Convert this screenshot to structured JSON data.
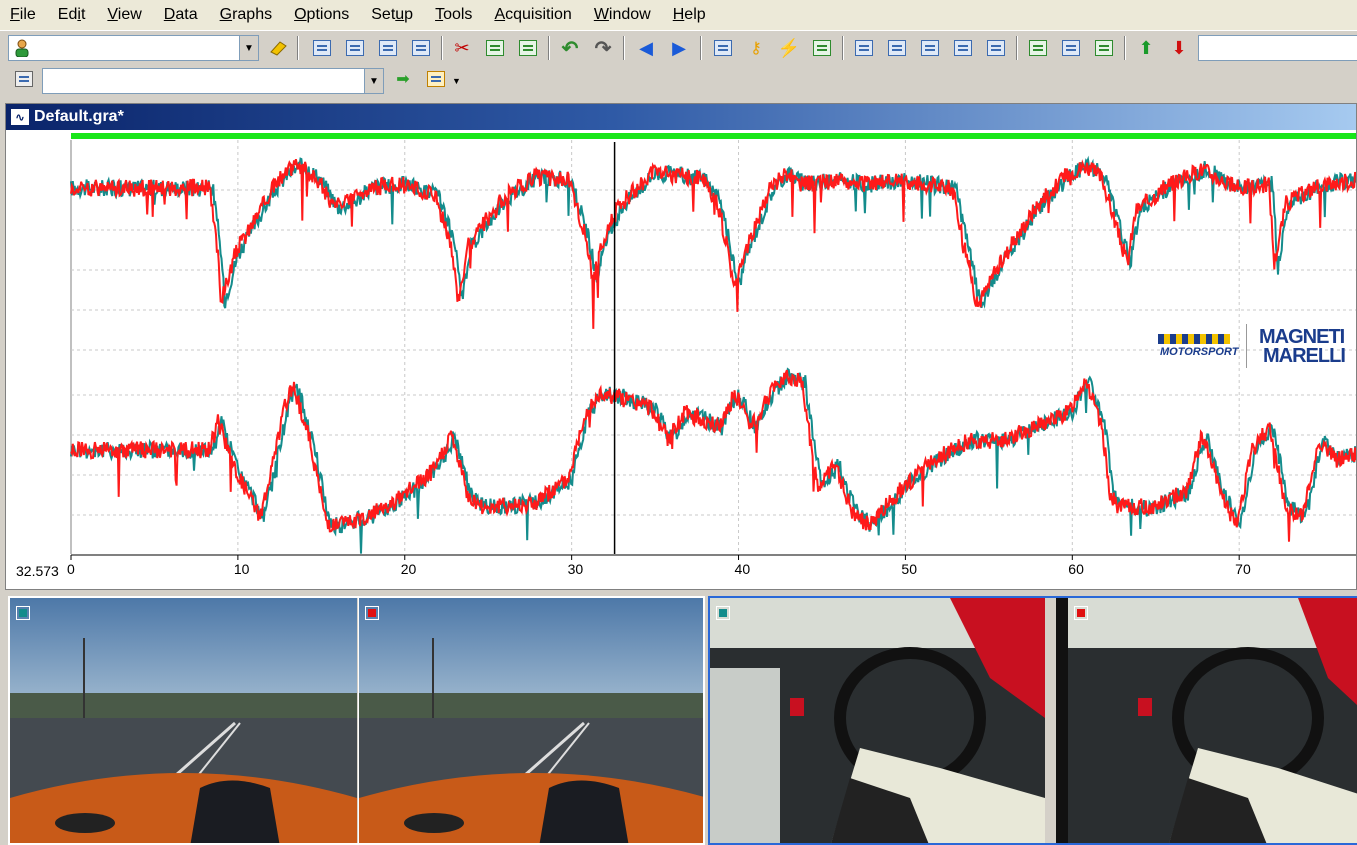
{
  "menu": [
    "File",
    "Edit",
    "View",
    "Data",
    "Graphs",
    "Options",
    "Setup",
    "Tools",
    "Acquisition",
    "Window",
    "Help"
  ],
  "menu_access_keys": [
    "F",
    "i",
    "V",
    "D",
    "G",
    "O",
    "u",
    "T",
    "A",
    "W",
    "H"
  ],
  "toolbar": {
    "user_combo_value": "",
    "secondary_combo_value": "",
    "right_input_value": ""
  },
  "graph_window": {
    "title": "Default.gra*",
    "cursor_value": "32.573",
    "x_ticks": [
      "0",
      "10",
      "20",
      "30",
      "40",
      "50",
      "60",
      "70"
    ],
    "logo_left": "MOTORSPORT",
    "logo_right_line1": "MAGNETI",
    "logo_right_line2": "MARELLI"
  },
  "colors": {
    "series_a": "#148c8c",
    "series_b": "#ff1a1a",
    "range_bar": "#19e619",
    "cursor": "#000000"
  },
  "chart_data": {
    "type": "line",
    "x_range": [
      0,
      77
    ],
    "cursor_x": 32.573,
    "grid": true,
    "panels": [
      {
        "name": "",
        "series": [
          {
            "name": "",
            "color": "teal",
            "x": [
              0,
              8.5,
              9,
              9.2,
              10,
              12,
              13,
              14,
              15,
              16,
              17,
              18,
              20,
              22,
              23,
              23.4,
              24,
              26,
              28,
              30,
              31,
              31.5,
              32,
              33,
              35,
              38,
              39,
              40,
              40.5,
              42,
              43,
              44,
              46,
              48,
              50,
              53,
              54,
              54.5,
              56,
              58,
              60,
              61,
              62,
              63,
              63.5,
              64,
              66,
              68,
              70,
              72,
              72.3,
              73,
              75,
              77
            ],
            "y": [
              0.8,
              0.8,
              0.45,
              0.2,
              0.45,
              0.76,
              0.88,
              0.92,
              0.84,
              0.7,
              0.73,
              0.8,
              0.82,
              0.76,
              0.5,
              0.2,
              0.5,
              0.74,
              0.86,
              0.84,
              0.55,
              0.32,
              0.5,
              0.7,
              0.88,
              0.85,
              0.7,
              0.28,
              0.45,
              0.78,
              0.88,
              0.82,
              0.84,
              0.82,
              0.84,
              0.8,
              0.4,
              0.18,
              0.42,
              0.7,
              0.88,
              0.92,
              0.85,
              0.55,
              0.4,
              0.68,
              0.82,
              0.9,
              0.8,
              0.82,
              0.4,
              0.72,
              0.82,
              0.84
            ]
          },
          {
            "name": "",
            "color": "red",
            "x": [
              0,
              8.3,
              8.8,
              9,
              9.8,
              11.8,
              12.8,
              13.8,
              14.8,
              15.8,
              16.8,
              17.8,
              19.8,
              21.8,
              22.8,
              23.2,
              23.8,
              25.8,
              27.8,
              29.8,
              30.8,
              31.3,
              31.8,
              32.8,
              34.8,
              37.8,
              38.8,
              39.8,
              40.3,
              41.8,
              42.8,
              43.8,
              45.8,
              47.8,
              49.8,
              52.8,
              53.8,
              54.3,
              55.8,
              57.8,
              59.8,
              60.8,
              61.8,
              62.8,
              63.3,
              63.8,
              65.8,
              67.8,
              69.8,
              71.8,
              72.1,
              72.8,
              74.8,
              77
            ],
            "y": [
              0.8,
              0.8,
              0.45,
              0.2,
              0.45,
              0.76,
              0.88,
              0.92,
              0.84,
              0.7,
              0.73,
              0.8,
              0.82,
              0.76,
              0.5,
              0.2,
              0.5,
              0.74,
              0.86,
              0.84,
              0.55,
              0.32,
              0.5,
              0.7,
              0.88,
              0.85,
              0.7,
              0.28,
              0.45,
              0.78,
              0.88,
              0.82,
              0.84,
              0.82,
              0.84,
              0.8,
              0.4,
              0.18,
              0.42,
              0.7,
              0.88,
              0.92,
              0.85,
              0.55,
              0.4,
              0.68,
              0.82,
              0.9,
              0.8,
              0.82,
              0.4,
              0.72,
              0.82,
              0.84
            ]
          }
        ]
      },
      {
        "name": "",
        "series": [
          {
            "name": "",
            "color": "teal",
            "x": [
              0,
              8.5,
              9,
              10,
              11.5,
              12,
              13,
              13.5,
              14.5,
              15.5,
              16,
              18,
              20,
              22,
              23,
              24,
              25,
              28,
              30,
              31,
              32,
              33,
              35,
              36,
              37,
              39,
              40,
              41,
              42,
              43,
              44,
              44.5,
              45,
              46,
              47,
              48,
              50,
              52,
              54,
              56,
              58,
              60,
              61,
              62,
              62.5,
              63,
              65,
              67,
              68,
              69,
              70,
              71,
              72,
              73,
              74,
              75,
              76,
              77
            ],
            "y": [
              0.5,
              0.5,
              0.65,
              0.4,
              0.15,
              0.3,
              0.72,
              0.85,
              0.55,
              0.12,
              0.1,
              0.15,
              0.25,
              0.4,
              0.58,
              0.25,
              0.2,
              0.22,
              0.35,
              0.7,
              0.8,
              0.78,
              0.72,
              0.55,
              0.7,
              0.62,
              0.8,
              0.62,
              0.78,
              0.9,
              0.85,
              0.55,
              0.3,
              0.42,
              0.18,
              0.1,
              0.3,
              0.45,
              0.55,
              0.55,
              0.62,
              0.7,
              0.88,
              0.6,
              0.25,
              0.2,
              0.2,
              0.28,
              0.58,
              0.3,
              0.1,
              0.5,
              0.62,
              0.2,
              0.15,
              0.55,
              0.45,
              0.48
            ]
          },
          {
            "name": "",
            "color": "red",
            "x": [
              0,
              8.3,
              8.8,
              9.8,
              11.3,
              11.8,
              12.8,
              13.3,
              14.3,
              15.3,
              15.8,
              17.8,
              19.8,
              21.8,
              22.8,
              23.8,
              24.8,
              27.8,
              29.8,
              30.8,
              31.8,
              32.8,
              34.8,
              35.8,
              36.8,
              38.8,
              39.8,
              40.8,
              41.8,
              42.8,
              43.8,
              44.3,
              44.8,
              45.8,
              46.8,
              47.8,
              49.8,
              51.8,
              53.8,
              55.8,
              57.8,
              59.8,
              60.8,
              61.8,
              62.3,
              62.8,
              64.8,
              66.8,
              67.8,
              68.8,
              69.8,
              70.8,
              71.8,
              72.8,
              73.8,
              74.8,
              75.8,
              77
            ],
            "y": [
              0.5,
              0.5,
              0.65,
              0.4,
              0.15,
              0.3,
              0.72,
              0.85,
              0.55,
              0.12,
              0.1,
              0.15,
              0.25,
              0.4,
              0.58,
              0.25,
              0.2,
              0.22,
              0.35,
              0.7,
              0.8,
              0.78,
              0.72,
              0.55,
              0.7,
              0.62,
              0.8,
              0.62,
              0.78,
              0.9,
              0.85,
              0.55,
              0.3,
              0.42,
              0.18,
              0.1,
              0.3,
              0.45,
              0.55,
              0.55,
              0.62,
              0.7,
              0.88,
              0.6,
              0.25,
              0.2,
              0.2,
              0.28,
              0.58,
              0.3,
              0.1,
              0.5,
              0.62,
              0.2,
              0.15,
              0.55,
              0.45,
              0.48
            ]
          }
        ]
      }
    ]
  },
  "videos": [
    {
      "channel": "teal",
      "view": "front camera"
    },
    {
      "channel": "red",
      "view": "front camera"
    },
    {
      "channel": "teal",
      "view": "cockpit camera"
    },
    {
      "channel": "red",
      "view": "cockpit camera"
    }
  ]
}
